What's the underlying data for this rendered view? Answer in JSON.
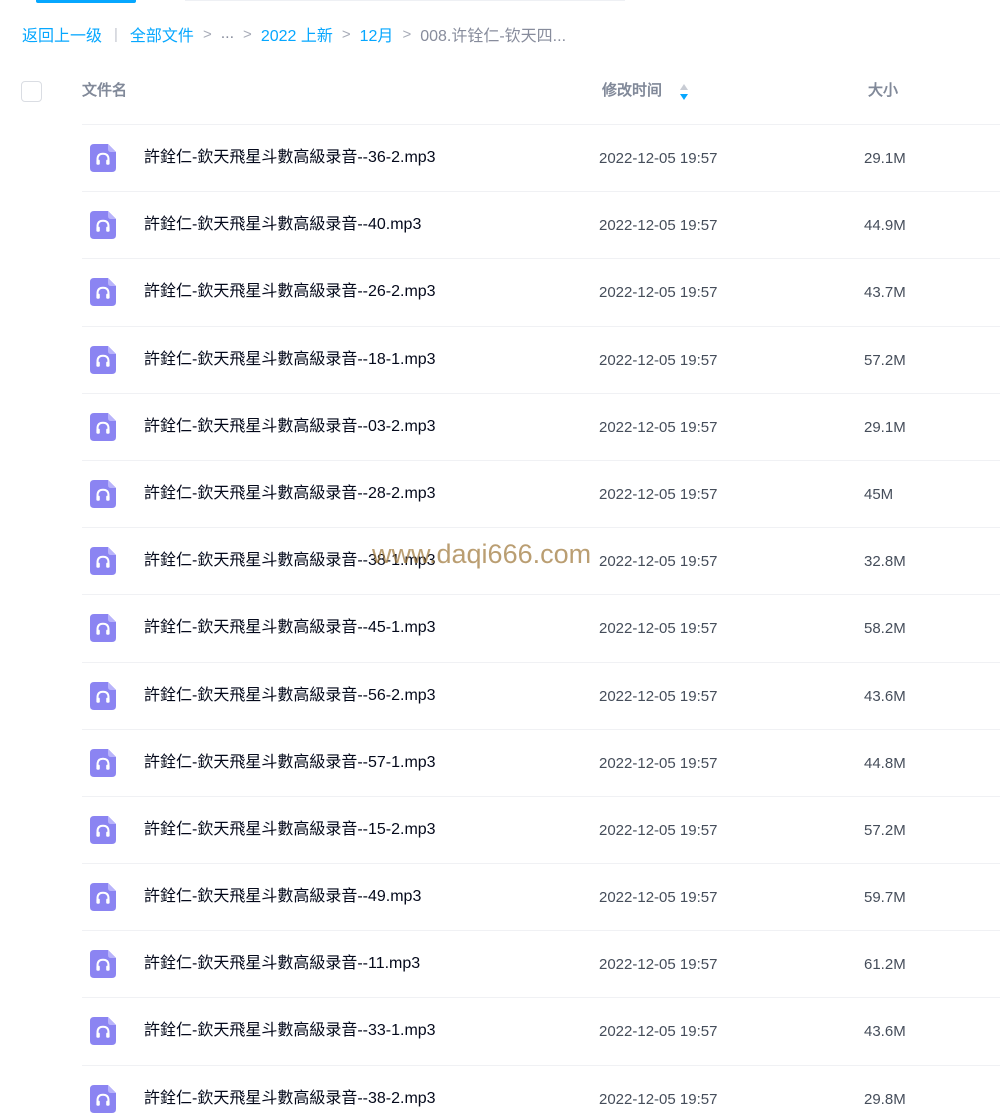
{
  "breadcrumb": {
    "back": "返回上一级",
    "all_files": "全部文件",
    "ellipsis": "...",
    "folder_1": "2022 上新",
    "folder_2": "12月",
    "current": "008.许铨仁-钦天四..."
  },
  "columns": {
    "name": "文件名",
    "modified": "修改时间",
    "size": "大小"
  },
  "colors": {
    "accent": "#06a7ff",
    "audio_icon": "#8b84f2"
  },
  "icons": {
    "file": "audio-file-icon",
    "sort": "sort-icon"
  },
  "files": [
    {
      "name": "許銓仁-欽天飛星斗數高級录音--36-2.mp3",
      "time": "2022-12-05 19:57",
      "size": "29.1M"
    },
    {
      "name": "許銓仁-欽天飛星斗數高級录音--40.mp3",
      "time": "2022-12-05 19:57",
      "size": "44.9M"
    },
    {
      "name": "許銓仁-欽天飛星斗數高級录音--26-2.mp3",
      "time": "2022-12-05 19:57",
      "size": "43.7M"
    },
    {
      "name": "許銓仁-欽天飛星斗數高級录音--18-1.mp3",
      "time": "2022-12-05 19:57",
      "size": "57.2M"
    },
    {
      "name": "許銓仁-欽天飛星斗數高級录音--03-2.mp3",
      "time": "2022-12-05 19:57",
      "size": "29.1M"
    },
    {
      "name": "許銓仁-欽天飛星斗數高級录音--28-2.mp3",
      "time": "2022-12-05 19:57",
      "size": "45M"
    },
    {
      "name": "許銓仁-欽天飛星斗數高級录音--38-1.mp3",
      "time": "2022-12-05 19:57",
      "size": "32.8M"
    },
    {
      "name": "許銓仁-欽天飛星斗數高級录音--45-1.mp3",
      "time": "2022-12-05 19:57",
      "size": "58.2M"
    },
    {
      "name": "許銓仁-欽天飛星斗數高級录音--56-2.mp3",
      "time": "2022-12-05 19:57",
      "size": "43.6M"
    },
    {
      "name": "許銓仁-欽天飛星斗數高級录音--57-1.mp3",
      "time": "2022-12-05 19:57",
      "size": "44.8M"
    },
    {
      "name": "許銓仁-欽天飛星斗數高級录音--15-2.mp3",
      "time": "2022-12-05 19:57",
      "size": "57.2M"
    },
    {
      "name": "許銓仁-欽天飛星斗數高級录音--49.mp3",
      "time": "2022-12-05 19:57",
      "size": "59.7M"
    },
    {
      "name": "許銓仁-欽天飛星斗數高級录音--11.mp3",
      "time": "2022-12-05 19:57",
      "size": "61.2M"
    },
    {
      "name": "許銓仁-欽天飛星斗數高級录音--33-1.mp3",
      "time": "2022-12-05 19:57",
      "size": "43.6M"
    },
    {
      "name": "許銓仁-欽天飛星斗數高級录音--38-2.mp3",
      "time": "2022-12-05 19:57",
      "size": "29.8M"
    }
  ],
  "watermark": "www.daqi666.com"
}
